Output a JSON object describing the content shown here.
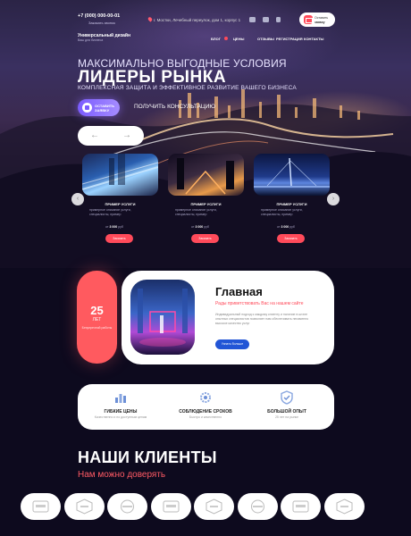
{
  "header": {
    "phone": "+7 (000) 000-00-01",
    "callback": "Заказать звонок",
    "address": "г. Мостки, Лечебный переулок, дом 1, корпус 1",
    "cta_line1": "Оставить",
    "cta_line2": "заявку",
    "logo": "Универсальный дизайн",
    "logo_sub": "Ваш для бизнеса",
    "nav": [
      "БЛОГ",
      "ЦЕНЫ",
      "ОТЗЫВЫ",
      "РЕГИСТРАЦИЯ",
      "КОНТАКТЫ"
    ]
  },
  "hero": {
    "pretitle": "МАКСИМАЛЬНО ВЫГОДНЫЕ УСЛОВИЯ",
    "title": "ЛИДЕРЫ РЫНКА",
    "subtitle": "КОМПЛЕКСНАЯ ЗАЩИТА И ЭФФЕКТИВНОЕ РАЗВИТИЕ ВАШЕГО БИЗНЕСА",
    "leave_btn": "ОСТАВИТЬ ЗАЯВКУ",
    "consult": "ПОЛУЧИТЬ КОНСУЛЬТАЦИЮ",
    "prev": "←",
    "next": "→"
  },
  "services": [
    {
      "title": "ПРИМЕР УСЛУГИ",
      "desc": "примерное описание услуги, специалисты, пример",
      "price_prefix": "от",
      "price": "3 000",
      "unit": "руб",
      "button": "Заказать"
    },
    {
      "title": "ПРИМЕР УСЛУГИ",
      "desc": "примерное описание услуги, специалисты, пример",
      "price_prefix": "от",
      "price": "3 000",
      "unit": "руб",
      "button": "Заказать"
    },
    {
      "title": "ПРИМЕР УСЛУГИ",
      "desc": "примерное описание услуги, специалисты, пример",
      "price_prefix": "от",
      "price": "3 000",
      "unit": "руб",
      "button": "Заказать"
    }
  ],
  "slider": {
    "left": "‹",
    "right": "›"
  },
  "experience": {
    "number": "25",
    "label": "ЛЕТ",
    "desc": "Безупречной работы"
  },
  "about": {
    "title": "Главная",
    "subtitle": "Рады приветствовать Вас на нашем сайте",
    "text": "Индивидуальный подход к каждому клиенту и наличие в штате опытных специалистов позволяет нам обеспечивать неизменно высокое качество услуг",
    "button": "Узнать больше"
  },
  "features": [
    {
      "title": "ГИБКИЕ ЦЕНЫ",
      "desc": "Качественно и по доступным ценам"
    },
    {
      "title": "СОБЛЮДЕНИЕ СРОКОВ",
      "desc": "Быстро и качественно"
    },
    {
      "title": "БОЛЬШОЙ ОПЫТ",
      "desc": "25 лет на рынке"
    }
  ],
  "clients": {
    "title": "НАШИ КЛИЕНТЫ",
    "subtitle": "Нам можно доверять",
    "count": 8
  },
  "colors": {
    "accent": "#ff4a5a",
    "purple": "#7b5cff",
    "blue": "#2255d6",
    "bg": "#0d0a1e"
  }
}
